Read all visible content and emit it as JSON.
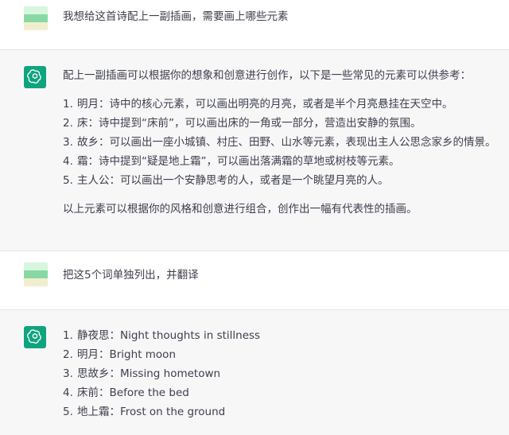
{
  "messages": [
    {
      "role": "user",
      "avatar_icon": "user-avatar-icon",
      "text": "我想给这首诗配上一副插画，需要画上哪些元素"
    },
    {
      "role": "assistant",
      "avatar_icon": "chatgpt-logo-icon",
      "intro": "配上一副插画可以根据你的想象和创意进行创作，以下是一些常见的元素可以供参考：",
      "items": [
        {
          "num": "1.",
          "text": "明月：诗中的核心元素，可以画出明亮的月亮，或者是半个月亮悬挂在天空中。"
        },
        {
          "num": "2.",
          "text": "床：诗中提到“床前”，可以画出床的一角或一部分，营造出安静的氛围。"
        },
        {
          "num": "3.",
          "text": "故乡：可以画出一座小城镇、村庄、田野、山水等元素，表现出主人公思念家乡的情景。"
        },
        {
          "num": "4.",
          "text": "霜：诗中提到“疑是地上霜”，可以画出落满霜的草地或树枝等元素。"
        },
        {
          "num": "5.",
          "text": "主人公：可以画出一个安静思考的人，或者是一个眺望月亮的人。"
        }
      ],
      "outro": "以上元素可以根据你的风格和创意进行组合，创作出一幅有代表性的插画。"
    },
    {
      "role": "user",
      "avatar_icon": "user-avatar-icon",
      "text": "把这5个词单独列出，并翻译"
    },
    {
      "role": "assistant",
      "avatar_icon": "chatgpt-logo-icon",
      "items": [
        {
          "num": "1.",
          "text": "静夜思：Night thoughts in stillness"
        },
        {
          "num": "2.",
          "text": "明月：Bright moon"
        },
        {
          "num": "3.",
          "text": "思故乡：Missing hometown"
        },
        {
          "num": "4.",
          "text": "床前：Before the bed"
        },
        {
          "num": "5.",
          "text": "地上霜：Frost on the ground"
        }
      ]
    }
  ],
  "colors": {
    "user_bg": "#ffffff",
    "assistant_bg": "#f7f7f8",
    "logo_green": "#10a37f",
    "text": "#3d3f4c"
  }
}
